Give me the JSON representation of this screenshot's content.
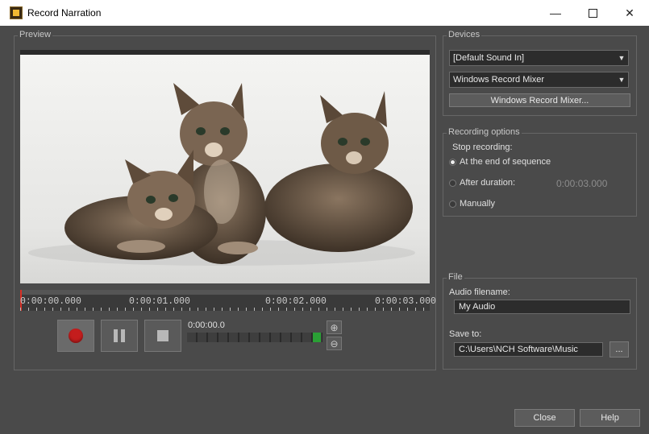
{
  "window": {
    "title": "Record Narration",
    "minimize": "—",
    "maximize": "",
    "close": "✕"
  },
  "preview": {
    "group_title": "Preview",
    "timeline_labels": [
      "0:00:00.000",
      "0:00:01.000",
      "0:00:02.000",
      "0:00:03.000"
    ],
    "current_time": "0:00:00.0"
  },
  "devices": {
    "group_title": "Devices",
    "input_device": "[Default Sound In]",
    "mixer_device": "Windows Record Mixer",
    "mixer_button": "Windows Record Mixer..."
  },
  "recording_options": {
    "group_title": "Recording options",
    "stop_label": "Stop recording:",
    "options": [
      {
        "label": "At the end of sequence",
        "checked": true
      },
      {
        "label": "After duration:",
        "checked": false
      },
      {
        "label": "Manually",
        "checked": false
      }
    ],
    "duration_value": "0:00:03.000"
  },
  "file": {
    "group_title": "File",
    "filename_label": "Audio filename:",
    "filename_value": "My Audio",
    "save_label": "Save to:",
    "save_path": "C:\\Users\\NCH Software\\Music",
    "browse_button": "..."
  },
  "footer": {
    "close_button": "Close",
    "help_button": "Help"
  },
  "colors": {
    "window_bg": "#4a4a4a",
    "record_red": "#c41d1d",
    "level_green": "#2aa035"
  },
  "icons": [
    "app-icon",
    "record-icon",
    "pause-icon",
    "stop-icon",
    "zoom-in-icon",
    "zoom-out-icon",
    "chevron-down-icon"
  ]
}
